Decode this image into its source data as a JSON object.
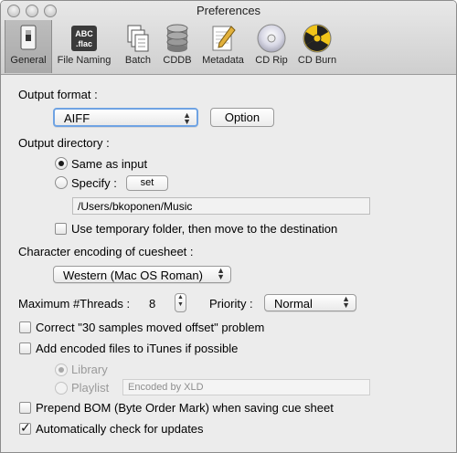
{
  "window": {
    "title": "Preferences"
  },
  "toolbar": {
    "items": [
      {
        "label": "General",
        "icon": "switch-icon",
        "selected": true
      },
      {
        "label": "File Naming",
        "icon": "abc-flac-icon",
        "icon_text_top": "ABC",
        "icon_text_bottom": ".flac"
      },
      {
        "label": "Batch",
        "icon": "documents-stack-icon"
      },
      {
        "label": "CDDB",
        "icon": "database-icon"
      },
      {
        "label": "Metadata",
        "icon": "pencil-paper-icon"
      },
      {
        "label": "CD Rip",
        "icon": "cd-disc-icon"
      },
      {
        "label": "CD Burn",
        "icon": "radiation-disc-icon"
      }
    ]
  },
  "output_format": {
    "label": "Output format :",
    "value": "AIFF",
    "option_button": "Option"
  },
  "output_directory": {
    "label": "Output directory :",
    "same_as_input": "Same as input",
    "specify": "Specify :",
    "set_button": "set",
    "path": "/Users/bkoponen/Music",
    "use_temp_folder": "Use temporary folder, then move to the destination"
  },
  "encoding": {
    "label": "Character encoding of cuesheet :",
    "value": "Western (Mac OS Roman)"
  },
  "threads": {
    "label": "Maximum #Threads :",
    "value": "8",
    "priority_label": "Priority :",
    "priority_value": "Normal"
  },
  "options": {
    "correct_offset": "Correct \"30 samples moved offset\" problem",
    "add_itunes": "Add encoded files to iTunes if possible",
    "library": "Library",
    "playlist": "Playlist",
    "playlist_placeholder": "Encoded by XLD",
    "prepend_bom": "Prepend BOM (Byte Order Mark) when saving cue sheet",
    "auto_update": "Automatically check for updates"
  },
  "colors": {
    "focus_ring": "#6fa3e3",
    "window_bg": "#ececec"
  }
}
